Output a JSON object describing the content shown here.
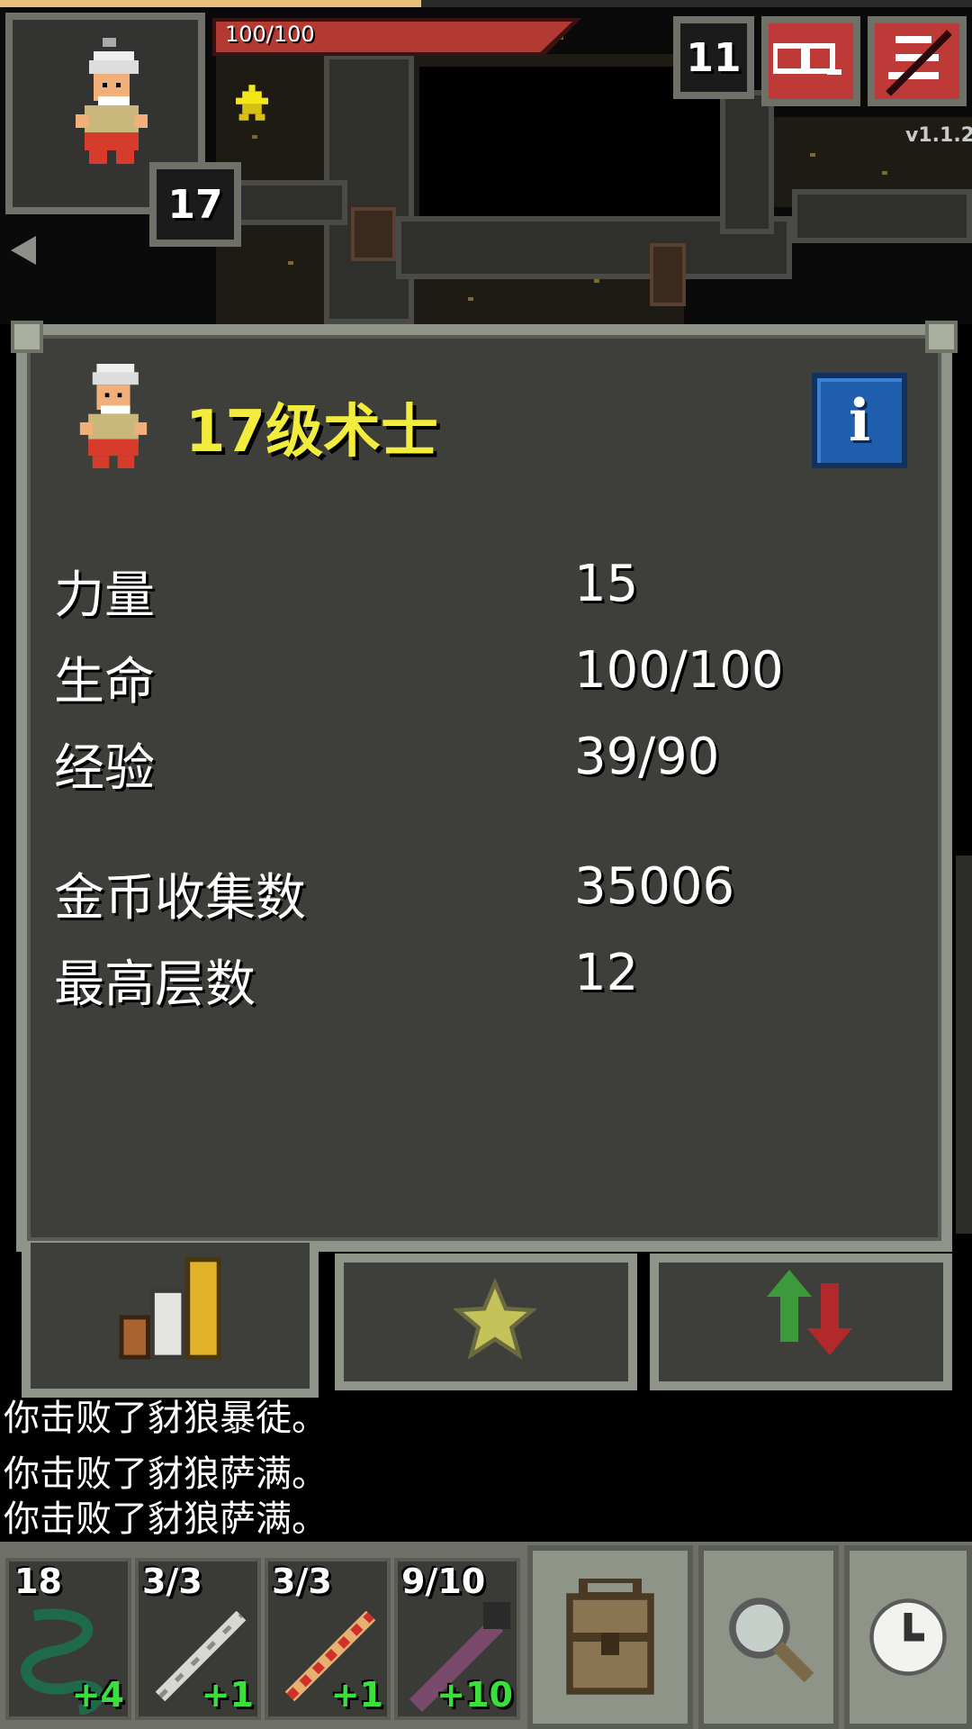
{
  "hud": {
    "hp_text": "100/100",
    "hp_fraction": 1.0,
    "hero_level": "17",
    "depth": "11",
    "version": "v1.1.2",
    "journal_icon": "journal-icon",
    "menu_icon": "menu-icon"
  },
  "panel": {
    "title": "17级术士",
    "stats": [
      {
        "label": "力量",
        "value": "15"
      },
      {
        "label": "生命",
        "value": "100/100"
      },
      {
        "label": "经验",
        "value": "39/90"
      },
      {
        "label": "金币收集数",
        "value": "35006"
      },
      {
        "label": "最高层数",
        "value": "12"
      }
    ],
    "tabs": [
      "stats-icon",
      "star-icon",
      "swap-icon"
    ]
  },
  "log": [
    "你击败了豺狼暴徒。",
    "你击败了豺狼萨满。",
    "你击败了豺狼萨满。"
  ],
  "quickslots": [
    {
      "count": "18",
      "bonus": "+4",
      "icon": "whip-icon"
    },
    {
      "count": "3/3",
      "bonus": "+1",
      "icon": "wand-silver-icon"
    },
    {
      "count": "3/3",
      "bonus": "+1",
      "icon": "wand-red-icon"
    },
    {
      "count": "9/10",
      "bonus": "+10",
      "icon": "staff-icon"
    }
  ],
  "toolbar": [
    "backpack-icon",
    "search-icon",
    "wait-icon"
  ],
  "colors": {
    "title": "#f2ec3c",
    "hp": "#b23a33",
    "bonus": "#39e039",
    "info": "#1f5fae"
  }
}
